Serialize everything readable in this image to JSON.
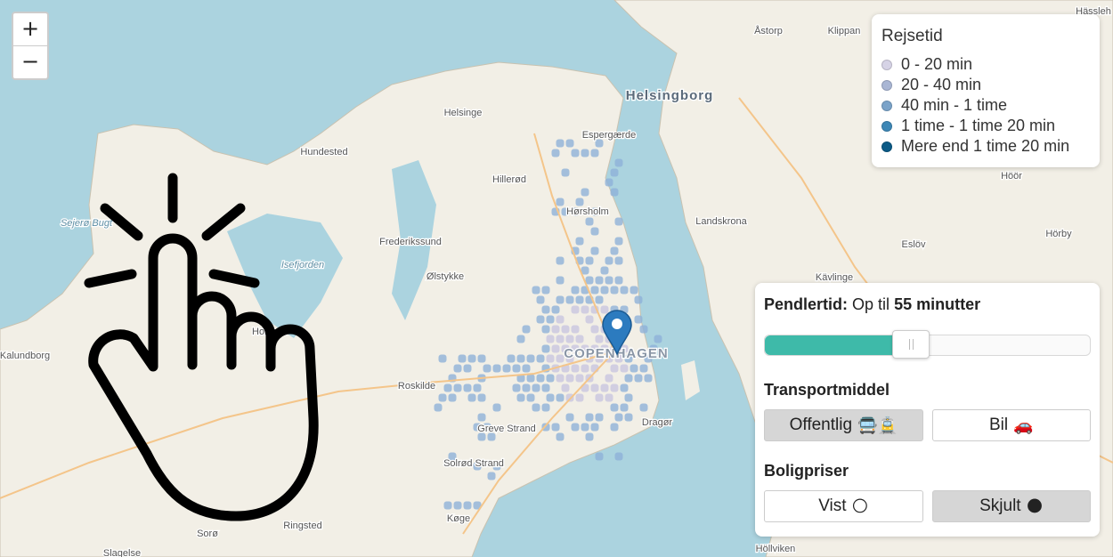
{
  "map": {
    "places": [
      {
        "name": "Helsingborg",
        "cls": "city"
      },
      {
        "name": "COPENHAGEN",
        "cls": "capital"
      },
      {
        "name": "Åstorp",
        "cls": "town"
      },
      {
        "name": "Klippan",
        "cls": "town"
      },
      {
        "name": "Hässleh",
        "cls": "town"
      },
      {
        "name": "Helsinge",
        "cls": "town"
      },
      {
        "name": "Espergærde",
        "cls": "town"
      },
      {
        "name": "Hundested",
        "cls": "town"
      },
      {
        "name": "Hillerød",
        "cls": "town"
      },
      {
        "name": "Höör",
        "cls": "town"
      },
      {
        "name": "Hørsholm",
        "cls": "town"
      },
      {
        "name": "Landskrona",
        "cls": "town"
      },
      {
        "name": "Frederikssund",
        "cls": "town"
      },
      {
        "name": "Eslöv",
        "cls": "town"
      },
      {
        "name": "Hörby",
        "cls": "town"
      },
      {
        "name": "Kävlinge",
        "cls": "town"
      },
      {
        "name": "Ølstykke",
        "cls": "town"
      },
      {
        "name": "Holbæk",
        "cls": "town"
      },
      {
        "name": "Kalundborg",
        "cls": "town"
      },
      {
        "name": "Roskilde",
        "cls": "town"
      },
      {
        "name": "Dragør",
        "cls": "town"
      },
      {
        "name": "Greve Strand",
        "cls": "town"
      },
      {
        "name": "Solrød Strand",
        "cls": "town"
      },
      {
        "name": "Køge",
        "cls": "town"
      },
      {
        "name": "Sorø",
        "cls": "town"
      },
      {
        "name": "Ringsted",
        "cls": "town"
      },
      {
        "name": "Slagelse",
        "cls": "town"
      },
      {
        "name": "Höllviken",
        "cls": "town"
      },
      {
        "name": "Sejerø Bugt",
        "cls": "water"
      },
      {
        "name": "Isefjorden",
        "cls": "water"
      }
    ]
  },
  "zoom": {
    "in": "+",
    "out": "−"
  },
  "legend": {
    "title": "Rejsetid",
    "items": [
      {
        "label": "0 - 20 min",
        "color": "#d6d3e6"
      },
      {
        "label": "20 - 40 min",
        "color": "#a9b6d4"
      },
      {
        "label": "40 min - 1 time",
        "color": "#7aa3c9"
      },
      {
        "label": "1 time - 1 time 20 min",
        "color": "#3d87b6"
      },
      {
        "label": "Mere end 1 time 20 min",
        "color": "#0b5a86"
      }
    ]
  },
  "panel": {
    "commute_label": "Pendlertid:",
    "commute_prefix": "Op til",
    "commute_value": "55 minutter",
    "slider_fraction": 0.45,
    "transport_title": "Transportmiddel",
    "transport_public": "Offentlig",
    "transport_public_icon": "🚍🚊",
    "transport_car": "Bil",
    "transport_car_icon": "🚗",
    "housing_title": "Boligpriser",
    "housing_show": "Vist",
    "housing_show_icon": "🌕",
    "housing_hide": "Skjult",
    "housing_hide_icon": "🌑"
  }
}
